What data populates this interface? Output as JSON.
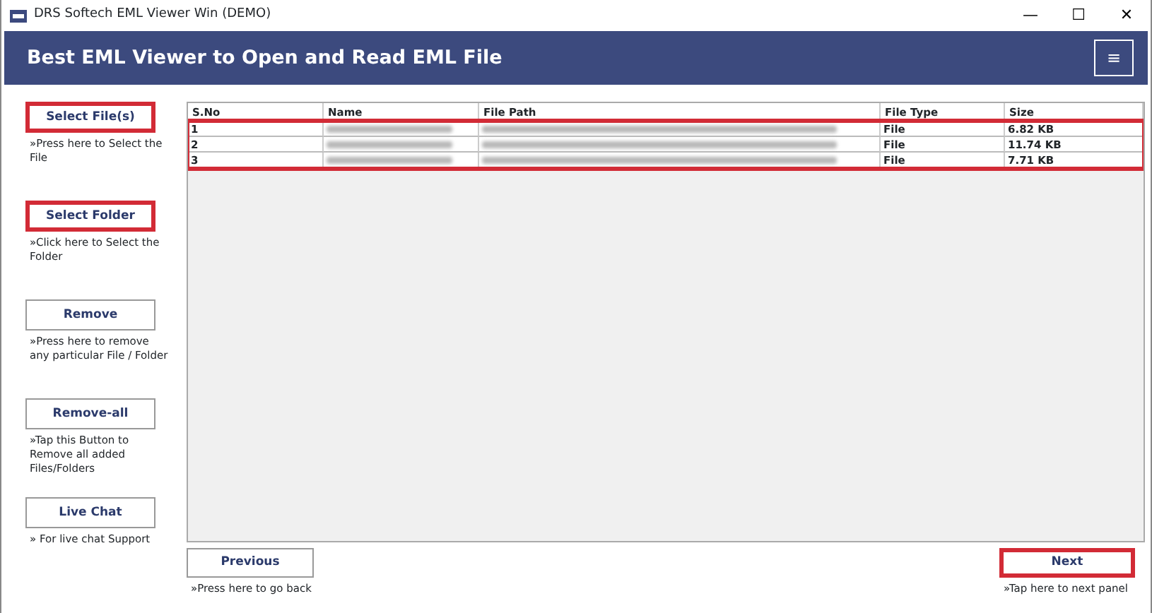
{
  "window": {
    "title": "DRS Softech EML Viewer Win (DEMO)",
    "controls": [
      "—",
      "☐",
      "✕"
    ]
  },
  "header": {
    "title": "Best EML Viewer to Open and Read EML File",
    "menu": "≡"
  },
  "sidebar": [
    {
      "label": "Select File(s)",
      "hint": "»Press here to Select the File",
      "highlighted": true
    },
    {
      "label": "Select Folder",
      "hint": "»Click here to Select the Folder",
      "highlighted": true
    },
    {
      "label": "Remove",
      "hint": "»Press here to remove any particular File / Folder",
      "highlighted": false
    },
    {
      "label": "Remove-all",
      "hint": "»Tap this Button to Remove all added Files/Folders",
      "highlighted": false
    },
    {
      "label": "Live Chat",
      "hint": "» For live chat Support",
      "highlighted": false
    }
  ],
  "table": {
    "columns": [
      "S.No",
      "Name",
      "File Path",
      "File Type",
      "Size"
    ],
    "rows_highlighted": true,
    "rows": [
      {
        "sno": "1",
        "redacted": true,
        "type": "File",
        "size": "6.82 KB"
      },
      {
        "sno": "2",
        "redacted": true,
        "type": "File",
        "size": "11.74 KB"
      },
      {
        "sno": "3",
        "redacted": true,
        "type": "File",
        "size": "7.71 KB"
      }
    ]
  },
  "footer": [
    {
      "label": "Previous",
      "hint": "»Press here to go back",
      "highlighted": false
    },
    {
      "label": "Next",
      "hint": "»Tap here to next panel",
      "highlighted": true
    }
  ]
}
